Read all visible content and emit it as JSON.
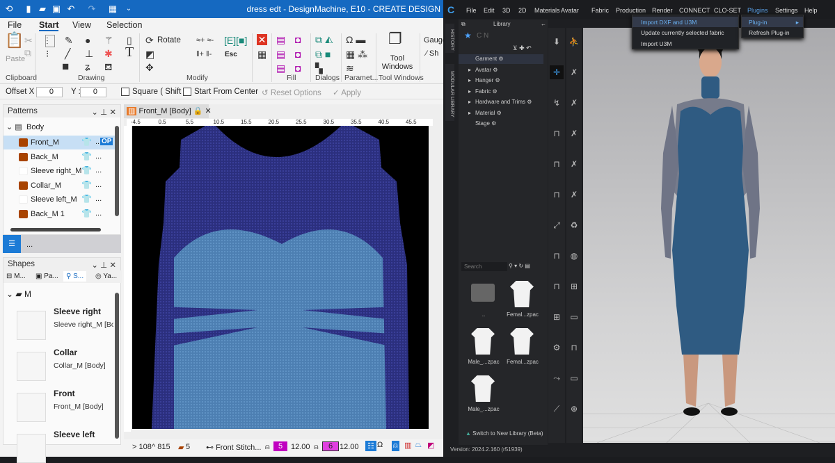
{
  "left_app": {
    "title": "dress edt - DesignMachine, E10 - CREATE DESIGN",
    "ribbon_tabs": [
      "File",
      "Start",
      "View",
      "Selection"
    ],
    "active_tab": "Start",
    "groups": [
      "Clipboard",
      "Drawing",
      "Modify",
      "Fill",
      "Dialogs",
      "Paramet...",
      "Tool Windows"
    ],
    "paste": "Paste",
    "rotate": "Rotate",
    "esc": "Esc",
    "tool_windows": "Tool Windows",
    "gauge": "Gauge",
    "sh": "Sh",
    "options": {
      "offset_x_label": "Offset X :",
      "offset_x": "0",
      "y_label": "Y :",
      "y": "0",
      "square": "Square ( Shift )",
      "start_center": "Start From Center",
      "reset": "Reset Options",
      "apply": "Apply"
    },
    "patterns": {
      "title": "Patterns",
      "root": "Body",
      "items": [
        {
          "label": "Front_M",
          "color": "#a84300",
          "selected": true,
          "badge": "OP"
        },
        {
          "label": "Back_M",
          "color": "#a84300"
        },
        {
          "label": "Sleeve right_M",
          "color": "#ffffff"
        },
        {
          "label": "Collar_M",
          "color": "#a84300"
        },
        {
          "label": "Sleeve left_M",
          "color": "#ffffff"
        },
        {
          "label": "Back_M 1",
          "color": "#a84300"
        }
      ],
      "more": "..."
    },
    "shapes": {
      "title": "Shapes",
      "tabs": [
        "M...",
        "Pa...",
        "S...",
        "Ya..."
      ],
      "root": "M",
      "items": [
        {
          "title": "Sleeve right",
          "sub": "Sleeve right_M [Body]"
        },
        {
          "title": "Collar",
          "sub": "Collar_M [Body]"
        },
        {
          "title": "Front",
          "sub": "Front_M [Body]"
        },
        {
          "title": "Sleeve left",
          "sub": ""
        }
      ]
    },
    "doc_tab": "Front_M [Body]",
    "ruler": [
      "-4.5",
      "0.5",
      "5.5",
      "10.5",
      "15.5",
      "20.5",
      "25.5",
      "30.5",
      "35.5",
      "40.5",
      "45.5"
    ],
    "status": {
      "x": "> 108",
      "y": "^ 815",
      "count": "5",
      "stitch": "Front Stitch...",
      "yarn1": "5",
      "val1": "12.00",
      "yarn2": "6",
      "val2": "12.00"
    },
    "colors": {
      "accent": "#1569c1",
      "body_knit": "#2b2f7e",
      "bust_knit": "#4d7fb2",
      "yarn": "#c000c0"
    }
  },
  "right_app": {
    "menu": [
      "File",
      "Edit",
      "3D",
      "2D",
      "Materials",
      "Avatar",
      "Fabric",
      "Production",
      "Render",
      "CONNECT",
      "CLO-SET",
      "Plugins",
      "Settings",
      "Help"
    ],
    "plugins_menu": [
      "Import DXF and U3M",
      "Update currently selected fabric",
      "Import U3M"
    ],
    "submenu": [
      "Plug-in",
      "Refresh Plug-in"
    ],
    "side_tabs": [
      "HISTORY",
      "MODULAR LIBRARY"
    ],
    "library": {
      "title": "Library",
      "tree": [
        "Garment",
        "Avatar",
        "Hanger",
        "Fabric",
        "Hardware and Trims",
        "Material",
        "Stage"
      ],
      "search_placeholder": "Search",
      "files": [
        "..",
        "Femal...zpac",
        "Male_...zpac",
        "Femal...zpac",
        "Male_...zpac"
      ],
      "switch": "Switch to New Library (Beta)"
    },
    "version": "Version: 2024.2.160 (r51939)",
    "colors": {
      "dress": "#2f5b82",
      "menu_highlight": "#5aa0e6"
    }
  }
}
